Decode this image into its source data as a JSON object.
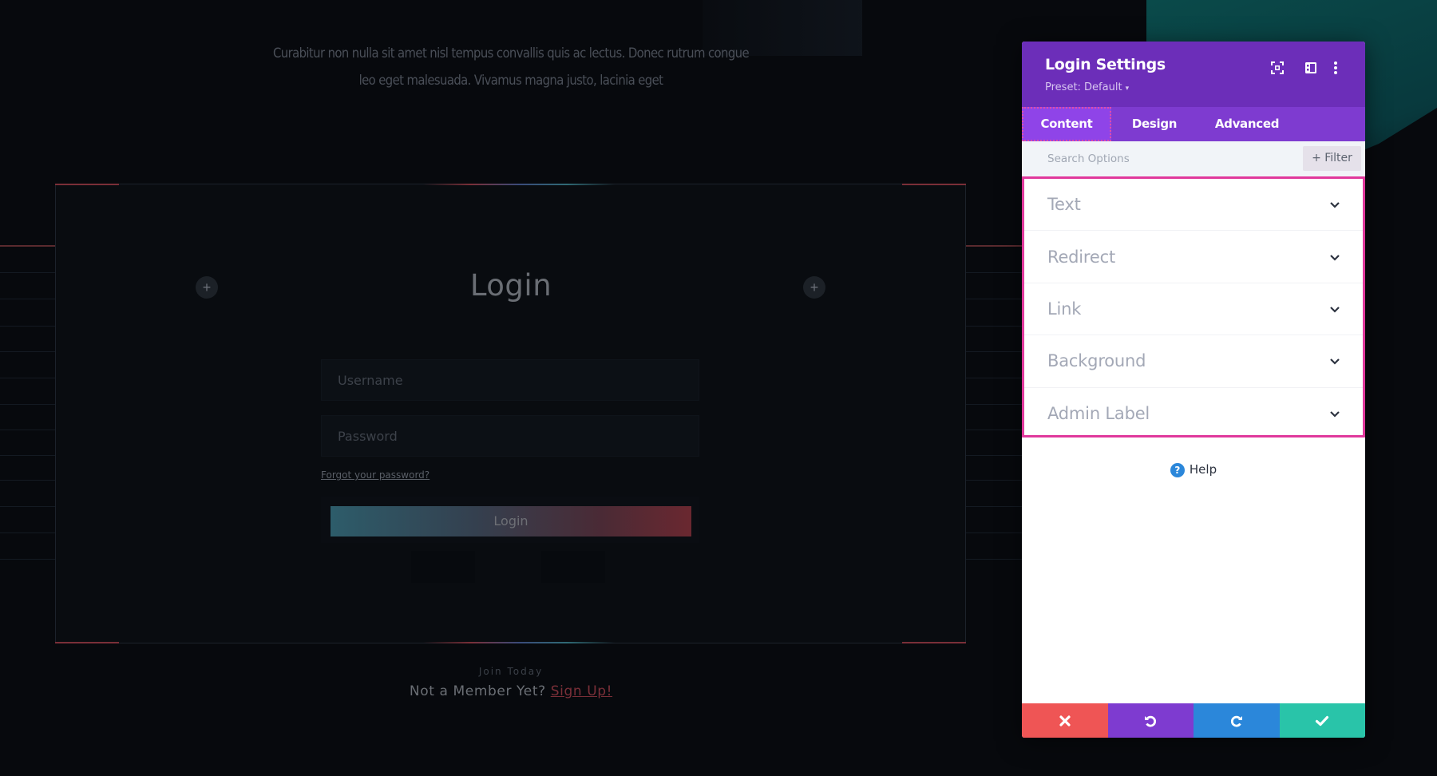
{
  "page": {
    "intro_text": "Curabitur non nulla sit amet nisl tempus convallis quis ac lectus. Donec rutrum congue leo eget malesuada. Vivamus magna justo, lacinia eget",
    "login_module": {
      "title": "Login",
      "username_placeholder": "Username",
      "password_placeholder": "Password",
      "forgot_link": "Forgot your password?",
      "submit_label": "Login"
    },
    "join_label": "Join Today",
    "member_prompt": "Not a Member Yet?",
    "signup_link": "Sign Up!",
    "add_icon": "+"
  },
  "panel": {
    "title": "Login Settings",
    "preset": "Preset: Default",
    "preset_caret": "▾",
    "header_icons": [
      "expand-icon",
      "split-view-icon",
      "more-options-icon"
    ],
    "tabs": [
      {
        "label": "Content",
        "active": true
      },
      {
        "label": "Design",
        "active": false
      },
      {
        "label": "Advanced",
        "active": false
      }
    ],
    "search": {
      "placeholder": "Search Options",
      "value": ""
    },
    "filter_label": "+ Filter",
    "toggles": [
      {
        "label": "Text"
      },
      {
        "label": "Redirect"
      },
      {
        "label": "Link"
      },
      {
        "label": "Background"
      },
      {
        "label": "Admin Label"
      }
    ],
    "help_label": "Help",
    "help_icon": "?",
    "footer_buttons": [
      {
        "name": "discard",
        "icon": "close-icon",
        "color": "#ef5555"
      },
      {
        "name": "undo",
        "icon": "undo-icon",
        "color": "#7e3bd0"
      },
      {
        "name": "redo",
        "icon": "redo-icon",
        "color": "#2b87da"
      },
      {
        "name": "save",
        "icon": "check-icon",
        "color": "#29c4a9"
      }
    ]
  },
  "colors": {
    "panel_header": "#6c2eb9",
    "panel_tabs": "#7e3bd0",
    "highlight": "#e0399c",
    "accent_red": "#7a2f38"
  }
}
